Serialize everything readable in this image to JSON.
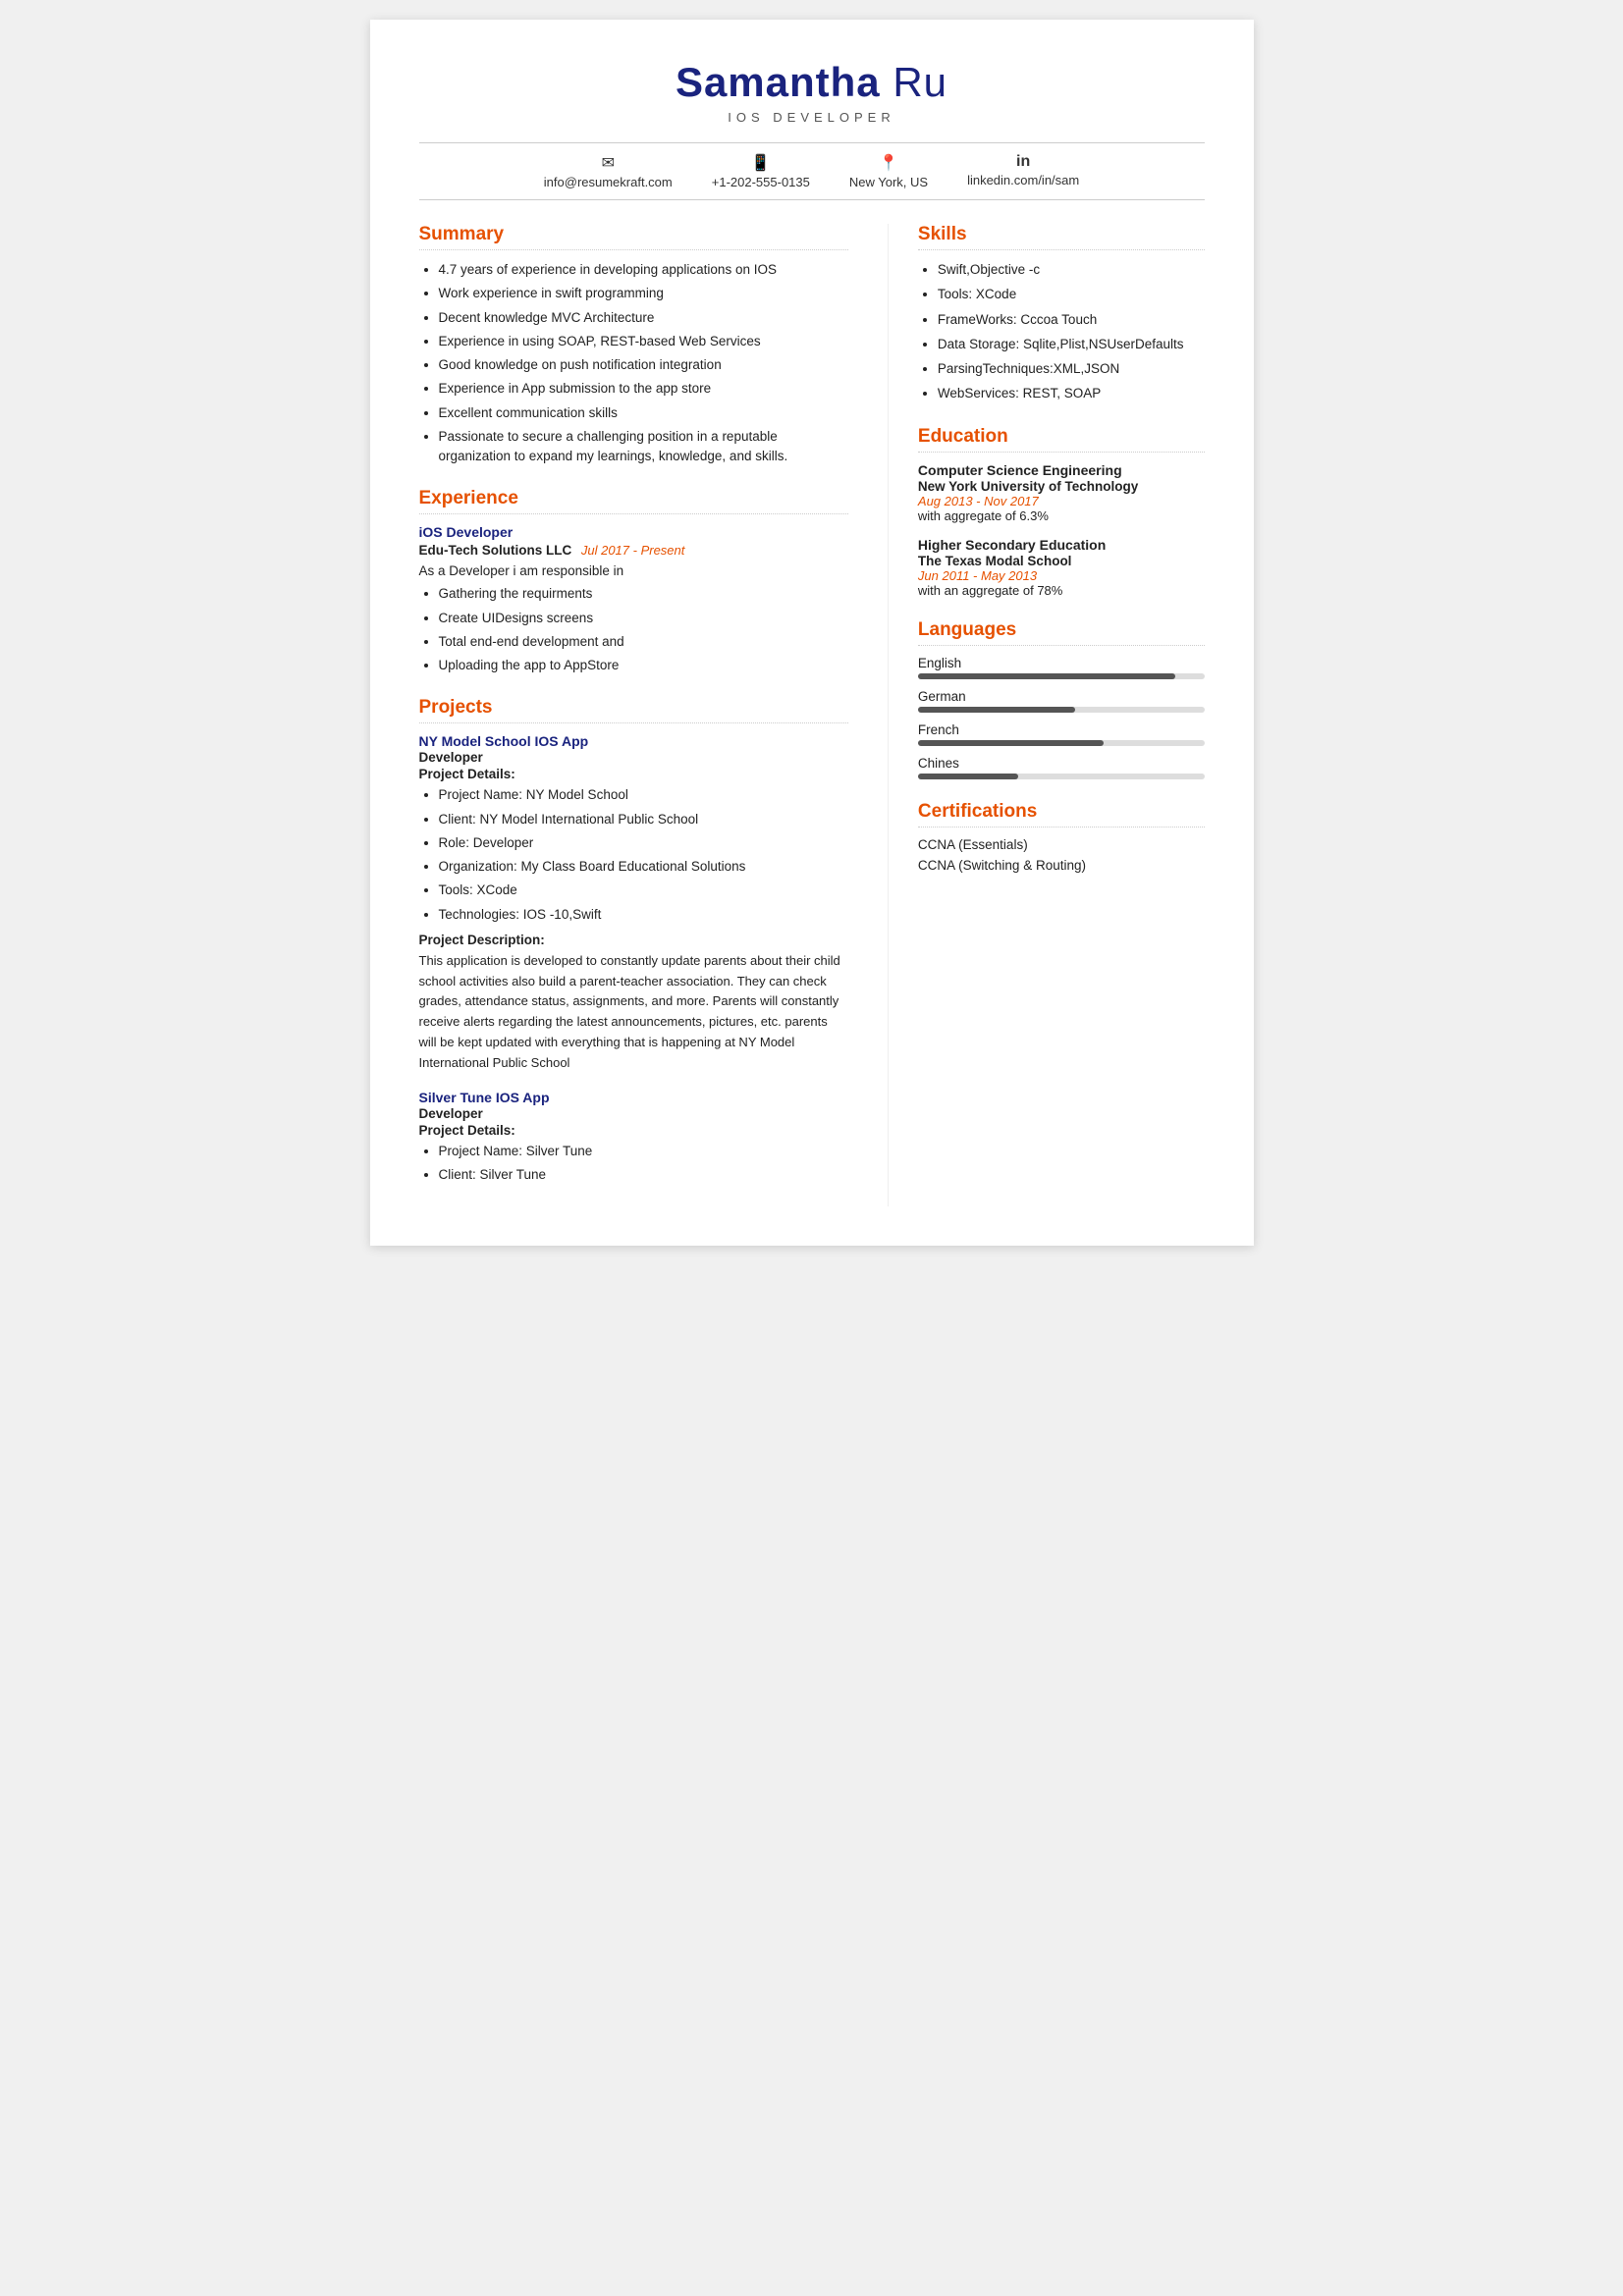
{
  "header": {
    "first_name": "Samantha",
    "last_name": "Ru",
    "title": "IOS DEVELOPER"
  },
  "contact": {
    "email": "info@resumekraft.com",
    "phone": "+1-202-555-0135",
    "location": "New York, US",
    "linkedin": "linkedin.com/in/sam"
  },
  "summary": {
    "section_title": "Summary",
    "items": [
      "4.7 years of experience in developing applications on IOS",
      "Work experience in swift programming",
      "Decent knowledge MVC Architecture",
      "Experience in using SOAP, REST-based Web Services",
      "Good knowledge on push notification integration",
      "Experience in App submission to the app store",
      "Excellent communication skills",
      "Passionate to secure a challenging position in a reputable organization to expand my learnings, knowledge, and skills."
    ]
  },
  "experience": {
    "section_title": "Experience",
    "jobs": [
      {
        "role": "iOS Developer",
        "company": "Edu-Tech Solutions LLC",
        "date": "Jul 2017 - Present",
        "description": "As a Developer i am responsible in",
        "responsibilities": [
          "Gathering the requirments",
          "Create UIDesigns  screens",
          "Total end-end  development and",
          "Uploading the app to AppStore"
        ]
      }
    ]
  },
  "projects": {
    "section_title": "Projects",
    "items": [
      {
        "name": "NY Model School IOS App",
        "role": "Developer",
        "details_label": "Project Details:",
        "details": [
          "Project Name: NY Model School",
          "Client: NY Model International Public School",
          "Role: Developer",
          "Organization: My Class Board Educational Solutions",
          "Tools: XCode",
          "Technologies: IOS -10,Swift"
        ],
        "desc_label": "Project Description:",
        "description": "This application is developed to constantly update parents about their child school activities also build a parent-teacher association. They can check grades, attendance status, assignments, and more. Parents will constantly receive alerts regarding the latest announcements, pictures, etc. parents will be kept updated with everything that is happening at NY Model International Public School"
      },
      {
        "name": "Silver Tune IOS App",
        "role": "Developer",
        "details_label": "Project Details:",
        "details": [
          "Project Name: Silver Tune",
          "Client: Silver Tune"
        ],
        "desc_label": "",
        "description": ""
      }
    ]
  },
  "skills": {
    "section_title": "Skills",
    "items": [
      "Swift,Objective -c",
      "Tools: XCode",
      "FrameWorks: Cccoa Touch",
      "Data Storage: Sqlite,Plist,NSUserDefaults",
      "ParsingTechniques:XML,JSON",
      "WebServices: REST, SOAP"
    ]
  },
  "education": {
    "section_title": "Education",
    "entries": [
      {
        "degree": "Computer Science Engineering",
        "school": "New York University of Technology",
        "date": "Aug 2013 - Nov 2017",
        "aggregate": "with aggregate of 6.3%"
      },
      {
        "degree": "Higher Secondary Education",
        "school": "The Texas Modal School",
        "date": "Jun 2011 - May 2013",
        "aggregate": "with an aggregate of 78%"
      }
    ]
  },
  "languages": {
    "section_title": "Languages",
    "items": [
      {
        "name": "English",
        "level": 90
      },
      {
        "name": "German",
        "level": 55
      },
      {
        "name": "French",
        "level": 65
      },
      {
        "name": "Chines",
        "level": 35
      }
    ]
  },
  "certifications": {
    "section_title": "Certifications",
    "items": [
      "CCNA (Essentials)",
      "CCNA (Switching & Routing)"
    ]
  }
}
